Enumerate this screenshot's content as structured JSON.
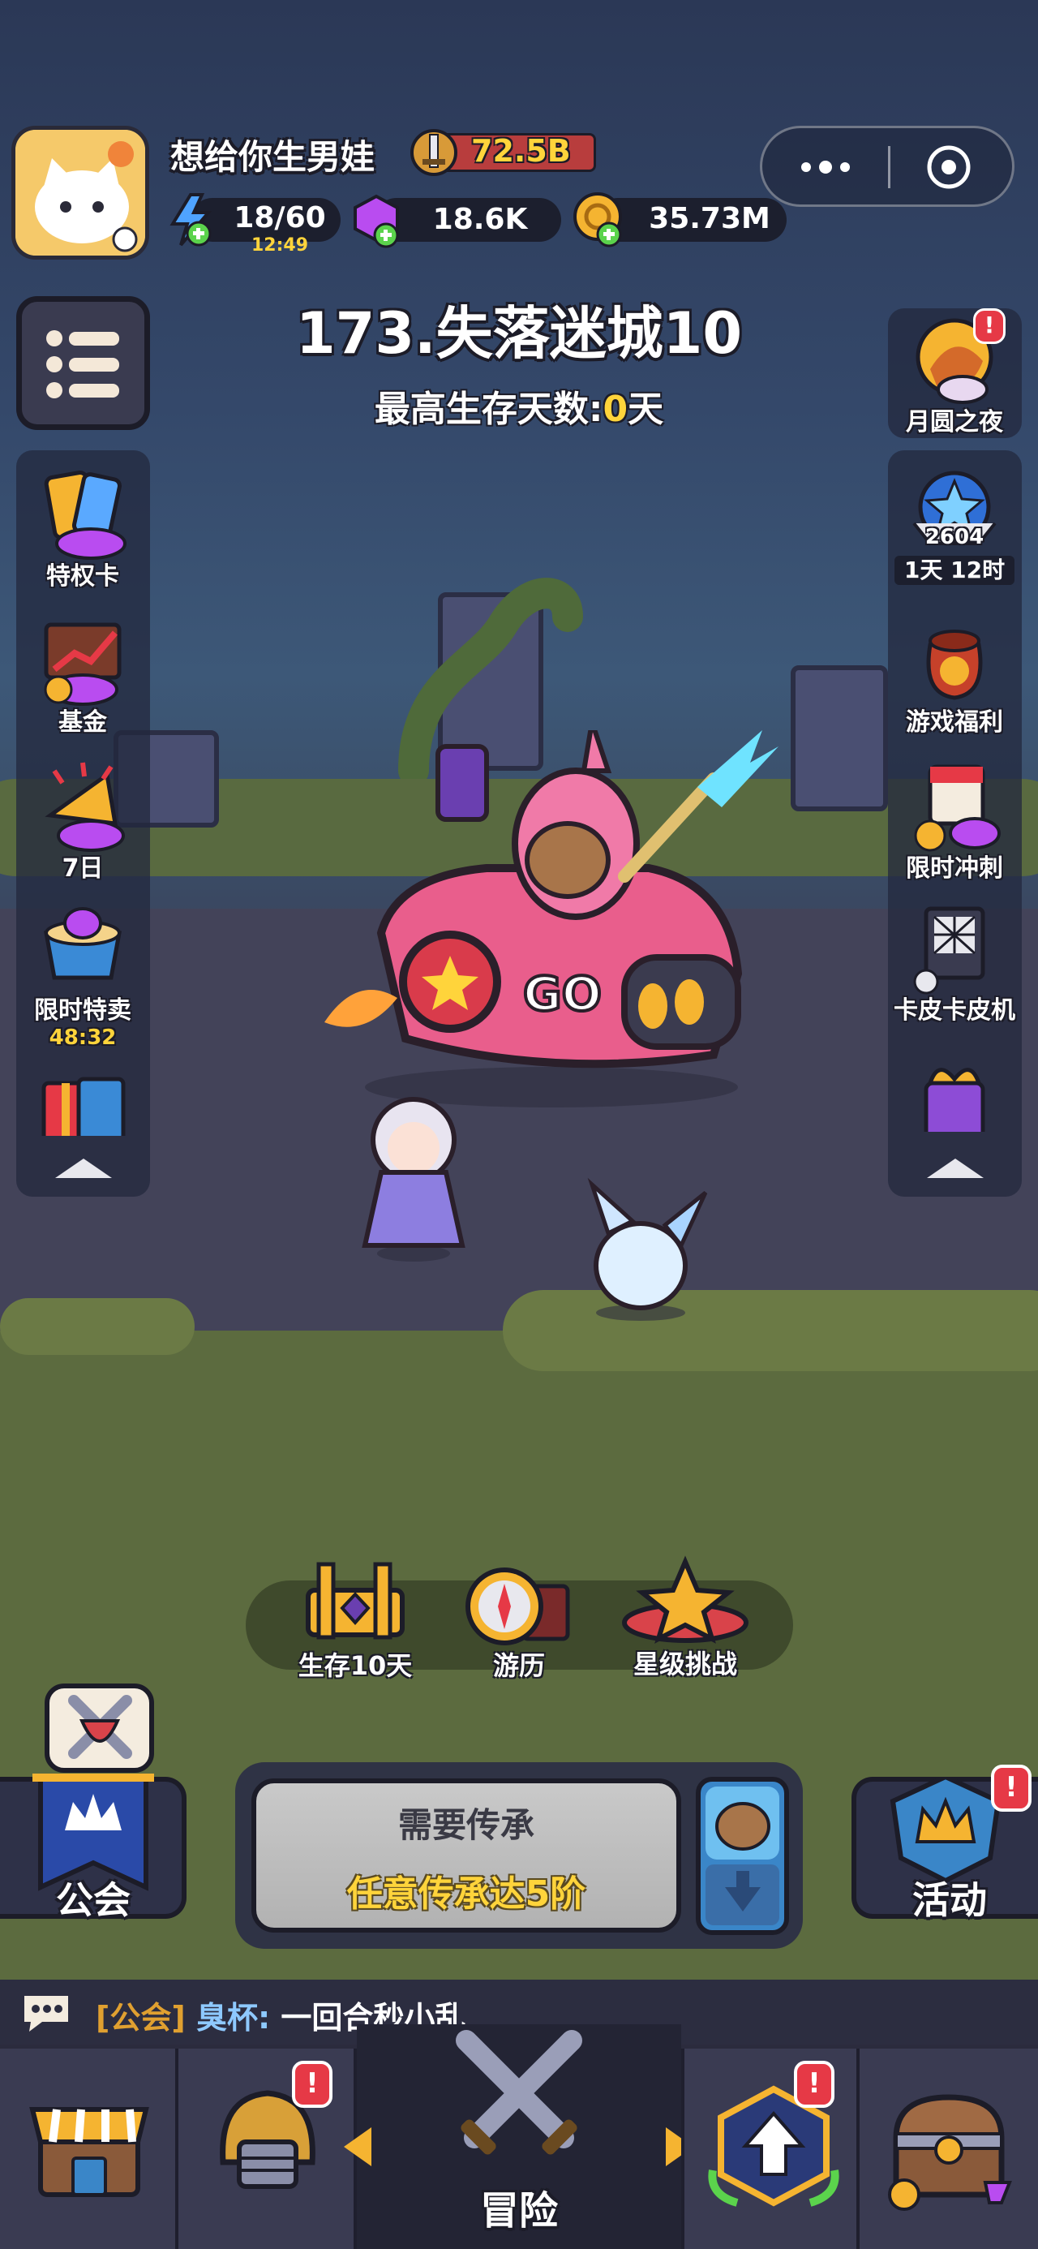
{
  "header": {
    "player_name": "想给你生男娃",
    "power": "72.5B",
    "energy": "18/60",
    "energy_timer": "12:49",
    "gems": "18.6K",
    "coins": "35.73M"
  },
  "stage": {
    "title": "173.失落迷城10",
    "survival_prefix": "最高生存天数:",
    "survival_value": "0",
    "survival_suffix": "天"
  },
  "left_sidebar": {
    "items": [
      {
        "label": "特权卡",
        "icon": "privilege-card-icon"
      },
      {
        "label": "基金",
        "icon": "fund-chart-icon"
      },
      {
        "label": "7日",
        "icon": "seven-day-icon"
      },
      {
        "label": "限时特卖",
        "timer": "48:32",
        "icon": "limited-sale-icon"
      },
      {
        "label": "",
        "icon": "gift-box-icon"
      }
    ]
  },
  "right_sidebar": {
    "top_item": {
      "label": "月圆之夜",
      "badge": "!"
    },
    "items": [
      {
        "label": "1天 12时",
        "rank": "2604",
        "icon": "star-rank-icon"
      },
      {
        "label": "游戏福利",
        "icon": "lucky-bag-icon"
      },
      {
        "label": "限时冲刺",
        "icon": "calendar-sprint-icon"
      },
      {
        "label": "卡皮卡皮机",
        "icon": "claw-machine-icon"
      },
      {
        "label": "",
        "icon": "gift-bow-icon"
      }
    ]
  },
  "mode_bar": {
    "items": [
      {
        "label": "生存10天",
        "icon": "chest-icon"
      },
      {
        "label": "游历",
        "icon": "compass-icon"
      },
      {
        "label": "星级挑战",
        "icon": "star-trophy-icon"
      }
    ]
  },
  "guild_button": {
    "label": "公会"
  },
  "main_button": {
    "line1": "需要传承",
    "line2": "任意传承达5阶"
  },
  "activity_button": {
    "label": "活动",
    "badge": "!"
  },
  "chat": {
    "channel": "[公会]",
    "sender": "臭杯:",
    "message": "一回合秒小乱"
  },
  "bottom_nav": {
    "items": [
      {
        "label": "",
        "icon": "shop-icon"
      },
      {
        "label": "",
        "icon": "helmet-icon",
        "badge": "!"
      },
      {
        "label": "冒险",
        "icon": "crossed-swords-icon"
      },
      {
        "label": "",
        "icon": "upgrade-arrow-icon",
        "badge": "!"
      },
      {
        "label": "",
        "icon": "treasure-chest-icon"
      }
    ]
  },
  "colors": {
    "gold_text": "#ffd43b",
    "name_text": "#ffffff",
    "chat_channel": "#e0a030",
    "red_badge": "#e63946"
  }
}
